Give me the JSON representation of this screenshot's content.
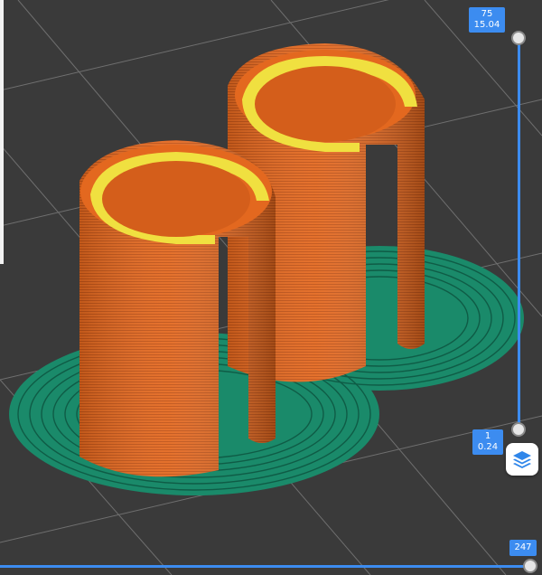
{
  "layer_slider": {
    "top": {
      "layer": "75",
      "height": "15.04"
    },
    "bottom": {
      "layer": "1",
      "height": "0.24"
    }
  },
  "move_slider": {
    "value": "247"
  },
  "toolbar": {
    "layers_icon": "layers-icon"
  },
  "colors": {
    "background": "#3a3a3a",
    "perimeter": "#e0661f",
    "infill": "#1a8a6a",
    "top_layer": "#f0e040",
    "slider_accent": "#3c8cf0"
  }
}
